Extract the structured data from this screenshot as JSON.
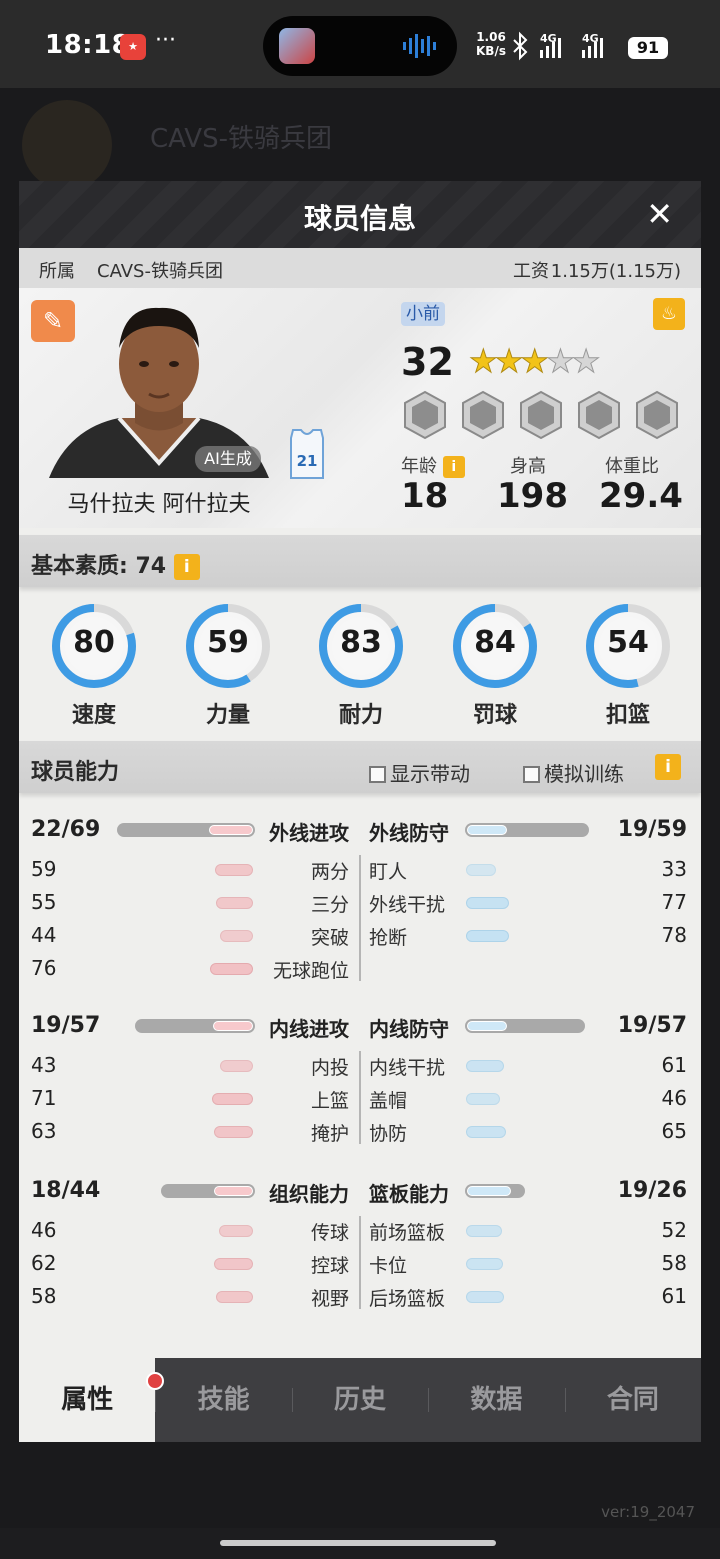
{
  "status_bar": {
    "time": "18:18",
    "dots": "···",
    "speed_top": "1.06",
    "speed_bottom": "KB/s",
    "network_1": "4G",
    "network_2": "4G",
    "battery": "91",
    "icons": [
      "app-notification-icon",
      "bluetooth-icon",
      "signal-icon",
      "battery-icon"
    ]
  },
  "background": {
    "team_title": "CAVS-铁骑兵团"
  },
  "modal": {
    "title": "球员信息",
    "close_label": "✕",
    "team_label": "所属",
    "team_name": "CAVS-铁骑兵团",
    "salary_label": "工资",
    "salary_value": "1.15万(1.15万)"
  },
  "player": {
    "name": "马什拉夫 阿什拉夫",
    "ai_tag": "AI生成",
    "jersey_number": "21",
    "position": "小前",
    "overall": "32",
    "stars_filled": 3,
    "stars_total": 5,
    "age_label": "年龄",
    "age_value": "18",
    "height_label": "身高",
    "height_value": "198",
    "bmi_label": "体重比",
    "bmi_value": "29.4"
  },
  "basic": {
    "title": "基本素质: 74",
    "stats": [
      {
        "label": "速度",
        "value": "80",
        "fraction": 0.8
      },
      {
        "label": "力量",
        "value": "59",
        "fraction": 0.59
      },
      {
        "label": "耐力",
        "value": "83",
        "fraction": 0.83
      },
      {
        "label": "罚球",
        "value": "84",
        "fraction": 0.84
      },
      {
        "label": "扣篮",
        "value": "54",
        "fraction": 0.54
      }
    ]
  },
  "ability": {
    "title": "球员能力",
    "show_drive": "显示带动",
    "sim_training": "模拟训练",
    "groups": [
      {
        "left": {
          "name": "外线进攻",
          "total": "22/69",
          "fill": 0.32
        },
        "right": {
          "name": "外线防守",
          "total": "19/59",
          "fill": 0.32
        },
        "left_rows": [
          {
            "name": "两分",
            "value": "59",
            "fill": 0.59
          },
          {
            "name": "三分",
            "value": "55",
            "fill": 0.55
          },
          {
            "name": "突破",
            "value": "44",
            "fill": 0.44
          },
          {
            "name": "无球跑位",
            "value": "76",
            "fill": 0.76
          }
        ],
        "right_rows": [
          {
            "name": "盯人",
            "value": "33",
            "fill": 0.33
          },
          {
            "name": "外线干扰",
            "value": "77",
            "fill": 0.77
          },
          {
            "name": "抢断",
            "value": "78",
            "fill": 0.78
          }
        ]
      },
      {
        "left": {
          "name": "内线进攻",
          "total": "19/57",
          "fill": 0.33
        },
        "right": {
          "name": "内线防守",
          "total": "19/57",
          "fill": 0.33
        },
        "left_rows": [
          {
            "name": "内投",
            "value": "43",
            "fill": 0.43
          },
          {
            "name": "上篮",
            "value": "71",
            "fill": 0.71
          },
          {
            "name": "掩护",
            "value": "63",
            "fill": 0.63
          }
        ],
        "right_rows": [
          {
            "name": "内线干扰",
            "value": "61",
            "fill": 0.61
          },
          {
            "name": "盖帽",
            "value": "46",
            "fill": 0.46
          },
          {
            "name": "协防",
            "value": "65",
            "fill": 0.65
          }
        ]
      },
      {
        "left": {
          "name": "组织能力",
          "total": "18/44",
          "fill": 0.41
        },
        "right": {
          "name": "篮板能力",
          "total": "19/26",
          "fill": 0.73
        },
        "left_rows": [
          {
            "name": "传球",
            "value": "46",
            "fill": 0.46
          },
          {
            "name": "控球",
            "value": "62",
            "fill": 0.62
          },
          {
            "name": "视野",
            "value": "58",
            "fill": 0.58
          }
        ],
        "right_rows": [
          {
            "name": "前场篮板",
            "value": "52",
            "fill": 0.52
          },
          {
            "name": "卡位",
            "value": "58",
            "fill": 0.58
          },
          {
            "name": "后场篮板",
            "value": "61",
            "fill": 0.61
          }
        ]
      }
    ]
  },
  "tabs": [
    {
      "label": "属性",
      "active": true
    },
    {
      "label": "技能",
      "active": false,
      "badge": true
    },
    {
      "label": "历史",
      "active": false
    },
    {
      "label": "数据",
      "active": false
    },
    {
      "label": "合同",
      "active": false
    }
  ],
  "footer": {
    "version": "ver:19_2047"
  },
  "colors": {
    "ring_fill": "#3e9be4",
    "ring_track": "#d9d9d9",
    "attack_pill": "#f2b9bd",
    "defense_pill": "#bfe0f4",
    "info_icon": "#f3b21b",
    "badge_dot": "#e04141"
  }
}
